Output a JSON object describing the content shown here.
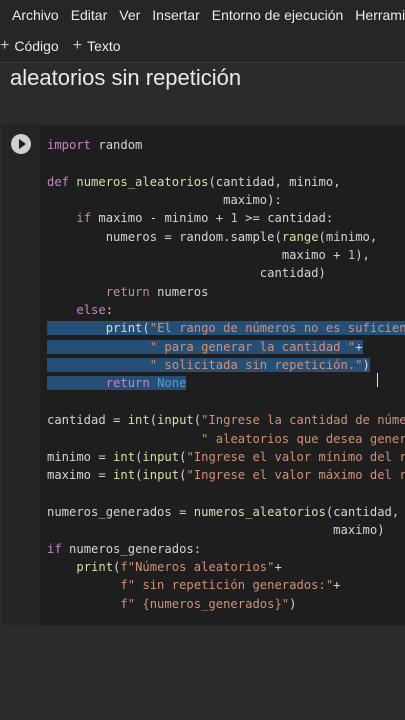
{
  "menu": [
    "Archivo",
    "Editar",
    "Ver",
    "Insertar",
    "Entorno de ejecución",
    "Herramie"
  ],
  "toolbar": {
    "code_label": "Código",
    "text_label": "Texto"
  },
  "heading": "aleatorios sin repetición",
  "code_lines": [
    "import random",
    "",
    "def numeros_aleatorios(cantidad, minimo,",
    "                        maximo):",
    "    if maximo - minimo + 1 >= cantidad:",
    "        numeros = random.sample(range(minimo,",
    "                                maximo + 1),",
    "                             cantidad)",
    "        return numeros",
    "    else:",
    "        print(\"El rango de números no es suficiente\"",
    "              \" para generar la cantidad \"+",
    "              \" solicitada sin repetición.\")",
    "        return None",
    "",
    "cantidad = int(input(\"Ingrese la cantidad de números\"",
    "                     \" aleatorios que desea generar: \"))",
    "minimo = int(input(\"Ingrese el valor mínimo del rango: \"))",
    "maximo = int(input(\"Ingrese el valor máximo del rango: \"))",
    "",
    "numeros_generados = numeros_aleatorios(cantidad, minimo,",
    "                                       maximo)",
    "if numeros_generados:",
    "    print(f\"Números aleatorios\"+",
    "          f\" sin repetición generados:\"+",
    "          f\" {numeros_generados}\")"
  ]
}
